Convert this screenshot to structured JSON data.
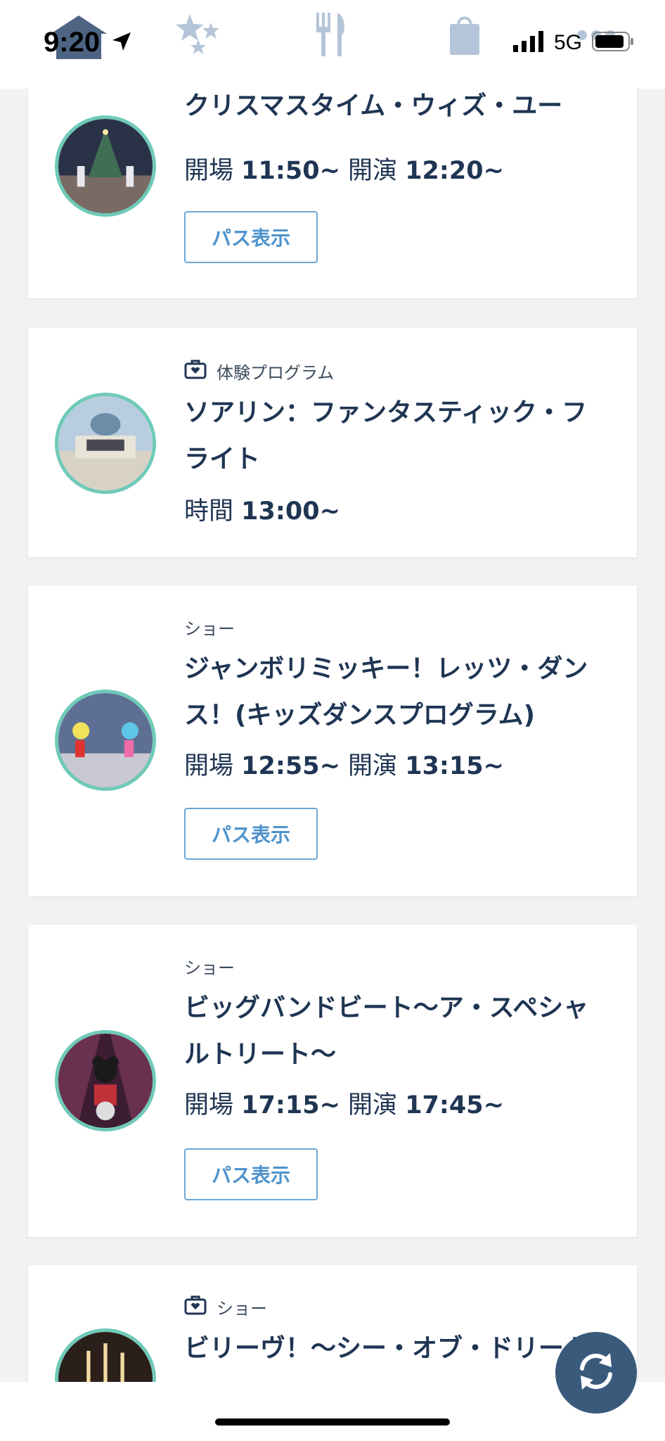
{
  "status_bar": {
    "time": "9:20",
    "carrier": "5G"
  },
  "nav": {
    "icons": [
      "home-icon",
      "sparkle-stars-icon",
      "restaurant-icon",
      "shopping-bag-icon",
      "more-icon"
    ]
  },
  "cards": [
    {
      "title": "クリスマスタイム・ウィズ・ユー",
      "time_lines": [
        {
          "label": "開場",
          "value": "11:50~"
        },
        {
          "label": "開演",
          "value": "12:20~"
        }
      ],
      "button": "パス表示"
    },
    {
      "category_icon": "ticket-icon",
      "category": "体験プログラム",
      "title_lines": [
        "ソアリン：ファンタスティック・フ",
        "ライト"
      ],
      "time_lines": [
        {
          "label": "時間",
          "value": "13:00~"
        }
      ]
    },
    {
      "category": "ショー",
      "title_lines": [
        "ジャンボリミッキー！レッツ・ダン",
        "ス！(キッズダンスプログラム)"
      ],
      "time_lines": [
        {
          "label": "開場",
          "value": "12:55~"
        },
        {
          "label": "開演",
          "value": "13:15~"
        }
      ],
      "button": "パス表示"
    },
    {
      "category": "ショー",
      "title_lines": [
        "ビッグバンドビート〜ア・スペシャ",
        "ルトリート〜"
      ],
      "time_lines": [
        {
          "label": "開場",
          "value": "17:15~"
        },
        {
          "label": "開演",
          "value": "17:45~"
        }
      ],
      "button": "パス表示"
    },
    {
      "category_icon": "ticket-icon",
      "category": "ショー",
      "title": "ビリーヴ！〜シー・オブ・ドリーム"
    }
  ],
  "colors": {
    "accent_ring": "#6fcab8",
    "button_border": "#6ea7d4",
    "title_text": "#1f3553",
    "refresh_button": "#3a5a7c"
  }
}
